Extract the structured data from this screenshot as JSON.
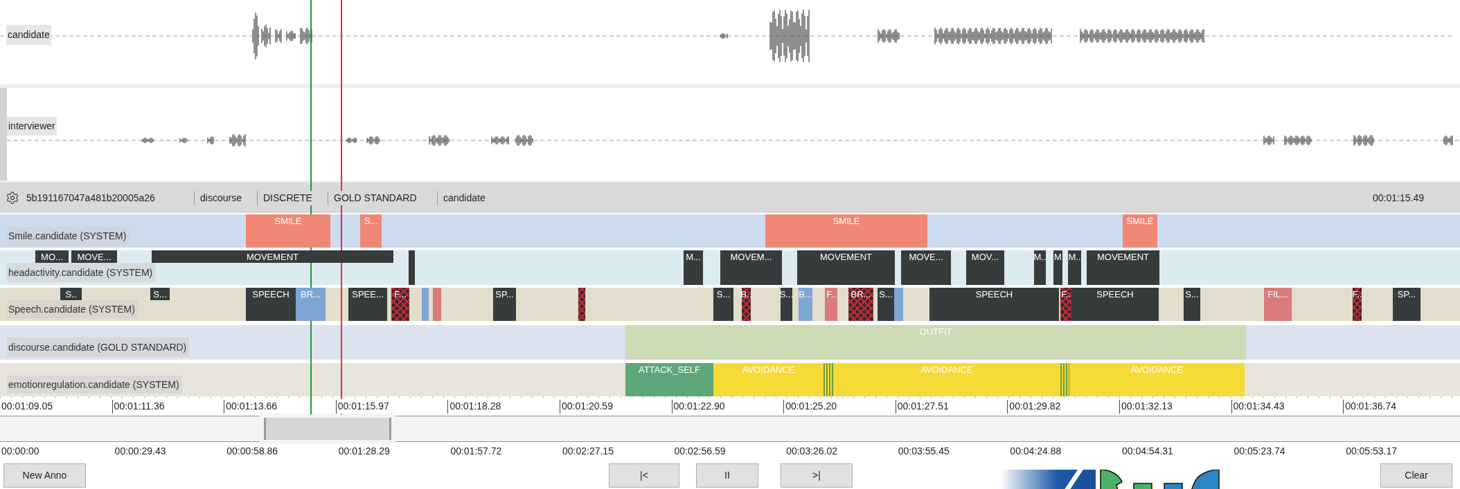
{
  "tracks": [
    {
      "label": "candidate"
    },
    {
      "label": "interviewer"
    }
  ],
  "tier_header": {
    "items": [
      "5b191167047a481b20005a26",
      "discourse",
      "DISCRETE",
      "GOLD STANDARD",
      "candidate"
    ],
    "time": "00:01:15.49"
  },
  "tiers": [
    {
      "name": "Smile.candidate (SYSTEM)",
      "segments": [
        {
          "label": "SMILE",
          "kind": "salmon"
        },
        {
          "label": "S...",
          "kind": "salmon"
        },
        {
          "label": "SMILE",
          "kind": "salmon"
        },
        {
          "label": "SMILE",
          "kind": "salmon"
        }
      ]
    },
    {
      "name": "headactivity.candidate (SYSTEM)",
      "segments": [
        {
          "label": "MO...",
          "kind": "dark"
        },
        {
          "label": "MOVE...",
          "kind": "dark"
        },
        {
          "label": "MOVEMENT",
          "kind": "dark"
        },
        {
          "kind": "dark"
        },
        {
          "label": "M...",
          "kind": "dark"
        },
        {
          "label": "MOVEM...",
          "kind": "dark"
        },
        {
          "label": "MOVEMENT",
          "kind": "dark"
        },
        {
          "label": "MOVE...",
          "kind": "dark"
        },
        {
          "label": "MOV...",
          "kind": "dark"
        },
        {
          "label": "M..",
          "kind": "dark"
        },
        {
          "label": "M",
          "kind": "dark"
        },
        {
          "label": "M..",
          "kind": "dark"
        },
        {
          "label": "MOVEMENT",
          "kind": "dark"
        }
      ]
    },
    {
      "name": "Speech.candidate (SYSTEM)",
      "segments": [
        {
          "label": "S..",
          "kind": "dark"
        },
        {
          "label": "S...",
          "kind": "dark"
        },
        {
          "label": "SPEECH",
          "kind": "dark"
        },
        {
          "label": "BR...",
          "kind": "blue"
        },
        {
          "label": "SPEE...",
          "kind": "dark"
        },
        {
          "label": "F...",
          "kind": "checkered"
        },
        {
          "kind": "blue"
        },
        {
          "kind": "pink"
        },
        {
          "label": "SP...",
          "kind": "dark"
        },
        {
          "kind": "checkered"
        },
        {
          "label": "S...",
          "kind": "dark"
        },
        {
          "label": "B..",
          "kind": "checkered"
        },
        {
          "label": "S...",
          "kind": "dark"
        },
        {
          "label": "B...",
          "kind": "blue"
        },
        {
          "label": "F..",
          "kind": "pink"
        },
        {
          "label": "BR...",
          "kind": "checkered"
        },
        {
          "label": "S...",
          "kind": "dark"
        },
        {
          "kind": "blue"
        },
        {
          "label": "SPEECH",
          "kind": "dark"
        },
        {
          "label": "F..",
          "kind": "checkered"
        },
        {
          "label": "SPEECH",
          "kind": "dark"
        },
        {
          "label": "S...",
          "kind": "dark"
        },
        {
          "label": "FIL...",
          "kind": "pink"
        },
        {
          "label": "F..",
          "kind": "checkered"
        },
        {
          "label": "SP...",
          "kind": "dark"
        }
      ]
    },
    {
      "name": "discourse.candidate (GOLD STANDARD)",
      "segments": [
        {
          "label": "OUTFIT",
          "kind": "pale"
        }
      ]
    },
    {
      "name": "emotionregulation.candidate (SYSTEM)",
      "segments": [
        {
          "label": "ATTACK_SELF",
          "kind": "green"
        },
        {
          "label": "AVOIDANCE",
          "kind": "yellow"
        },
        {
          "kind": "stripes"
        },
        {
          "label": "AVOIDANCE",
          "kind": "yellow"
        },
        {
          "kind": "stripes"
        },
        {
          "label": "AVOIDANCE",
          "kind": "yellow"
        }
      ]
    }
  ],
  "time_ruler": [
    "00:01:09.05",
    "00:01:11.36",
    "00:01:13.66",
    "00:01:15.97",
    "00:01:18.28",
    "00:01:20.59",
    "00:01:22.90",
    "00:01:25.20",
    "00:01:27.51",
    "00:01:29.82",
    "00:01:32.13",
    "00:01:34.43",
    "00:01:36.74"
  ],
  "overview_ruler": [
    "00:00:00",
    "00:00:29.43",
    "00:00:58.86",
    "00:01:28.29",
    "00:01:57.72",
    "00:02:27.15",
    "00:02:56.59",
    "00:03:26.02",
    "00:03:55.45",
    "00:04:24.88",
    "00:04:54.31",
    "00:05:23.74",
    "00:05:53.17"
  ],
  "buttons": {
    "new": "New Anno",
    "first": "|<",
    "pause": "II",
    "last": ">|",
    "clear": "Clear"
  }
}
